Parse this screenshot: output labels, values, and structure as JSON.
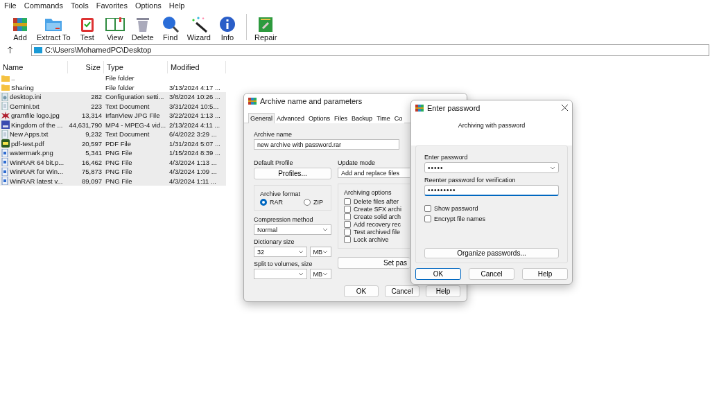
{
  "menu": [
    "File",
    "Commands",
    "Tools",
    "Favorites",
    "Options",
    "Help"
  ],
  "toolbar": {
    "main": [
      {
        "label": "Add",
        "kind": "add"
      },
      {
        "label": "Extract To",
        "kind": "extract"
      },
      {
        "label": "Test",
        "kind": "test"
      },
      {
        "label": "View",
        "kind": "view"
      },
      {
        "label": "Delete",
        "kind": "delete"
      },
      {
        "label": "Find",
        "kind": "find"
      },
      {
        "label": "Wizard",
        "kind": "wizard"
      },
      {
        "label": "Info",
        "kind": "info"
      }
    ],
    "extra": [
      {
        "label": "Repair",
        "kind": "repair"
      }
    ]
  },
  "address": "C:\\Users\\MohamedPC\\Desktop",
  "file_list": {
    "columns": [
      "Name",
      "Size",
      "Type",
      "Modified"
    ],
    "rows": [
      {
        "name": "..",
        "size": "",
        "type": "File folder",
        "modified": "",
        "kind": "folder",
        "selected": false
      },
      {
        "name": "Sharing",
        "size": "",
        "type": "File folder",
        "modified": "3/13/2024 4:17 ...",
        "kind": "folder",
        "selected": false
      },
      {
        "name": "desktop.ini",
        "size": "282",
        "type": "Configuration setti...",
        "modified": "3/8/2024 10:26 ...",
        "kind": "settings",
        "selected": true
      },
      {
        "name": "Gemini.txt",
        "size": "223",
        "type": "Text Document",
        "modified": "3/31/2024 10:5...",
        "kind": "text",
        "selected": true
      },
      {
        "name": "gramfile logo.jpg",
        "size": "13,314",
        "type": "IrfanView JPG File",
        "modified": "3/22/2024 1:13 ...",
        "kind": "jpg",
        "selected": true
      },
      {
        "name": "Kingdom of the ...",
        "size": "44,631,790",
        "type": "MP4 - MPEG-4 vid...",
        "modified": "2/13/2024 4:11 ...",
        "kind": "video",
        "selected": true
      },
      {
        "name": "New Apps.txt",
        "size": "9,232",
        "type": "Text Document",
        "modified": "6/4/2022 3:29 ...",
        "kind": "text",
        "selected": true
      },
      {
        "name": "pdf-test.pdf",
        "size": "20,597",
        "type": "PDF File",
        "modified": "1/31/2024 5:07 ...",
        "kind": "pdf",
        "selected": true
      },
      {
        "name": "watermark.png",
        "size": "5,341",
        "type": "PNG File",
        "modified": "1/15/2024 8:39 ...",
        "kind": "png",
        "selected": true
      },
      {
        "name": "WinRAR 64 bit.p...",
        "size": "16,462",
        "type": "PNG File",
        "modified": "4/3/2024 1:13 ...",
        "kind": "png",
        "selected": true
      },
      {
        "name": "WinRAR for Win...",
        "size": "75,873",
        "type": "PNG File",
        "modified": "4/3/2024 1:09 ...",
        "kind": "png",
        "selected": true
      },
      {
        "name": "WinRAR latest v...",
        "size": "89,097",
        "type": "PNG File",
        "modified": "4/3/2024 1:11 ...",
        "kind": "png",
        "selected": true
      }
    ]
  },
  "archive_dialog": {
    "title": "Archive name and parameters",
    "tabs": [
      {
        "label": "General",
        "selected": true
      },
      {
        "label": "Advanced",
        "selected": false
      },
      {
        "label": "Options",
        "selected": false
      },
      {
        "label": "Files",
        "selected": false
      },
      {
        "label": "Backup",
        "selected": false
      },
      {
        "label": "Time",
        "selected": false
      },
      {
        "label": "Co",
        "selected": false
      }
    ],
    "archive_name_label": "Archive name",
    "archive_name": "new archive with password.rar",
    "default_profile_label": "Default Profile",
    "profiles_button": "Profiles...",
    "update_mode_label": "Update mode",
    "update_mode": "Add and replace files",
    "archive_format": {
      "label": "Archive format",
      "options": [
        {
          "label": "RAR",
          "selected": true
        },
        {
          "label": "ZIP",
          "selected": false
        }
      ]
    },
    "archiving_options": {
      "label": "Archiving options",
      "items": [
        {
          "label": "Delete files after",
          "checked": false
        },
        {
          "label": "Create SFX archi",
          "checked": false
        },
        {
          "label": "Create solid arch",
          "checked": false
        },
        {
          "label": "Add recovery rec",
          "checked": false
        },
        {
          "label": "Test archived file",
          "checked": false
        },
        {
          "label": "Lock archive",
          "checked": false
        }
      ]
    },
    "compression_method_label": "Compression method",
    "compression_method": "Normal",
    "dictionary_size_label": "Dictionary size",
    "dictionary_size": "32",
    "dictionary_unit": "MB",
    "split_label": "Split to volumes, size",
    "split_unit": "MB",
    "set_password_button": "Set pas",
    "buttons": [
      "OK",
      "Cancel",
      "Help"
    ]
  },
  "password_dialog": {
    "title": "Enter password",
    "subtitle": "Archiving with password",
    "enter_label": "Enter password",
    "password": "•••••",
    "reenter_label": "Reenter password for verification",
    "reenter_password": "•••••••••",
    "checkboxes": [
      {
        "label": "Show password",
        "checked": false
      },
      {
        "label": "Encrypt file names",
        "checked": false
      }
    ],
    "organize_button": "Organize passwords...",
    "buttons": [
      {
        "label": "OK",
        "default": true
      },
      {
        "label": "Cancel",
        "default": false
      },
      {
        "label": "Help",
        "default": false
      }
    ]
  }
}
